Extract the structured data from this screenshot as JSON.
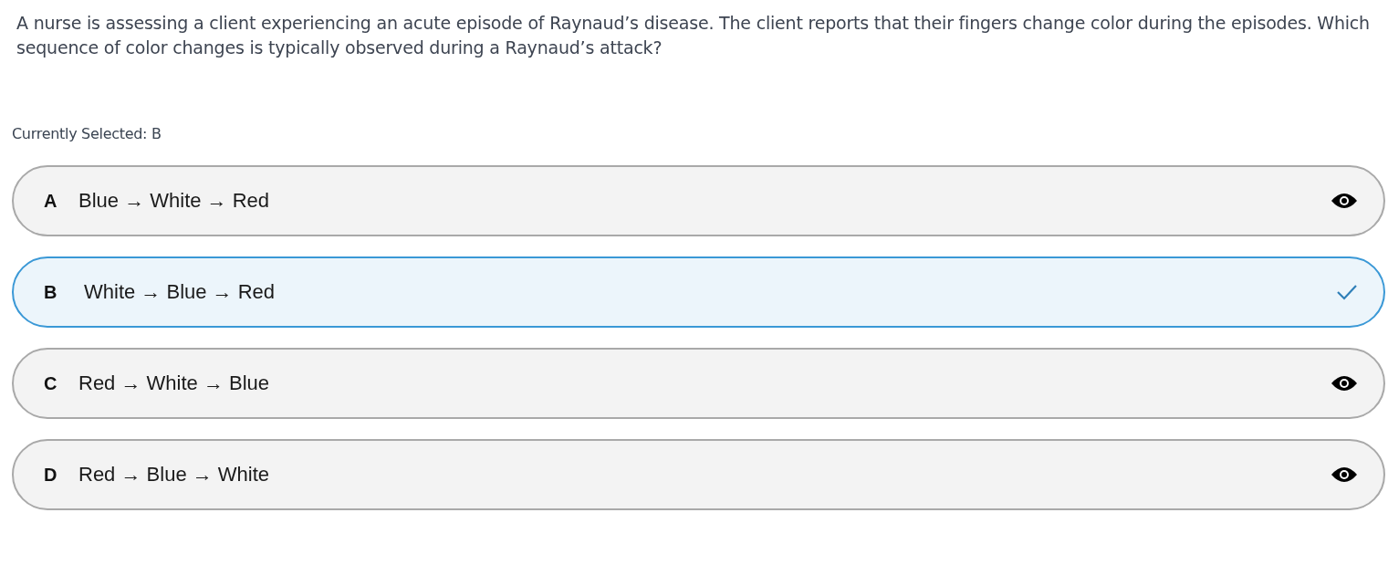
{
  "question": "A nurse is assessing a client experiencing an acute episode of Raynaud’s disease. The client reports that their fingers change color during the episodes. Which sequence of color changes is typically observed during a Raynaud’s attack?",
  "current_selection": "Currently Selected: B",
  "options": [
    {
      "letter": "A",
      "text": "Blue → White → Red",
      "selected": false
    },
    {
      "letter": "B",
      "text": "White → Blue → Red",
      "selected": true
    },
    {
      "letter": "C",
      "text": "Red → White → Blue",
      "selected": false
    },
    {
      "letter": "D",
      "text": "Red → Blue → White",
      "selected": false
    }
  ]
}
